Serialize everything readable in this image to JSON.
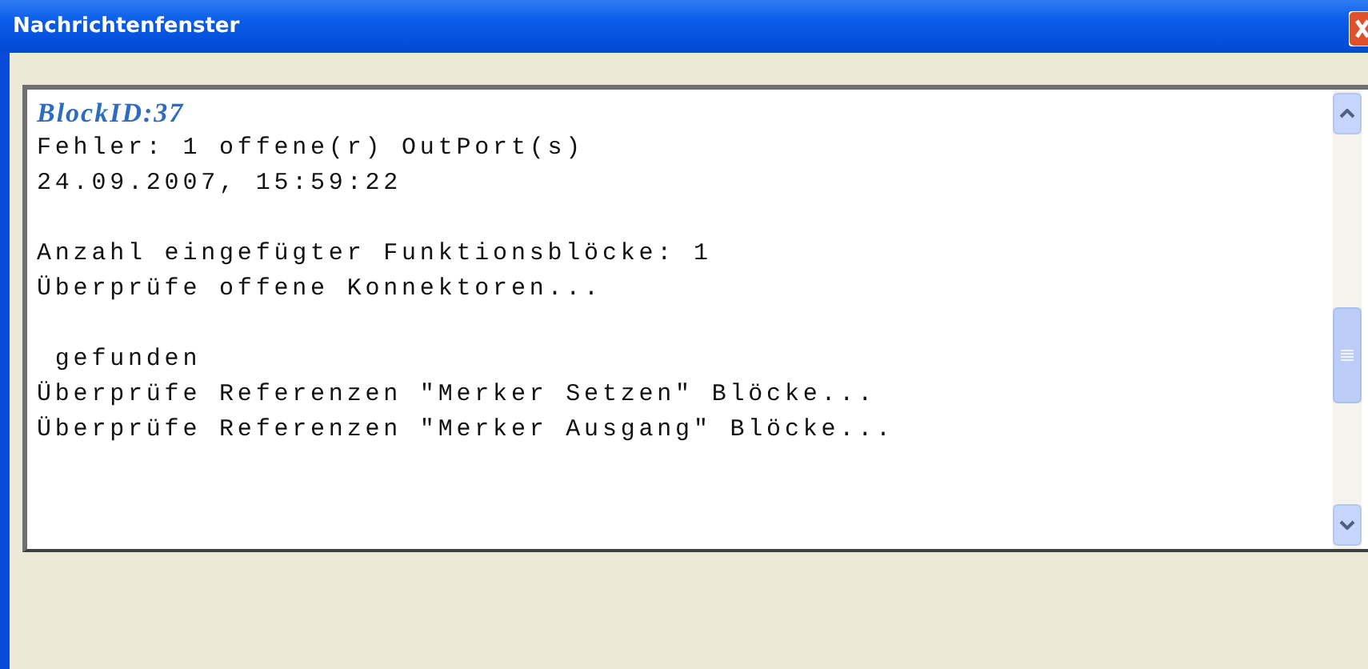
{
  "window": {
    "title": "Nachrichtenfenster"
  },
  "messages": [
    {
      "lines": [
        {
          "kind": "heading",
          "text": "BlockID:37"
        },
        {
          "kind": "text",
          "text": "Fehler: 1 offene(r) OutPort(s)"
        },
        {
          "kind": "text",
          "text": "24.09.2007, 15:59:22"
        }
      ]
    },
    {
      "lines": [
        {
          "kind": "text",
          "text": "Anzahl eingefügter Funktionsblöcke: 1"
        },
        {
          "kind": "text",
          "text": "Überprüfe offene Konnektoren..."
        }
      ]
    },
    {
      "lines": [
        {
          "kind": "text",
          "text": " gefunden"
        },
        {
          "kind": "text",
          "text": "Überprüfe Referenzen \"Merker Setzen\" Blöcke..."
        },
        {
          "kind": "text",
          "text": "Überprüfe Referenzen \"Merker Ausgang\" Blöcke..."
        }
      ]
    }
  ]
}
